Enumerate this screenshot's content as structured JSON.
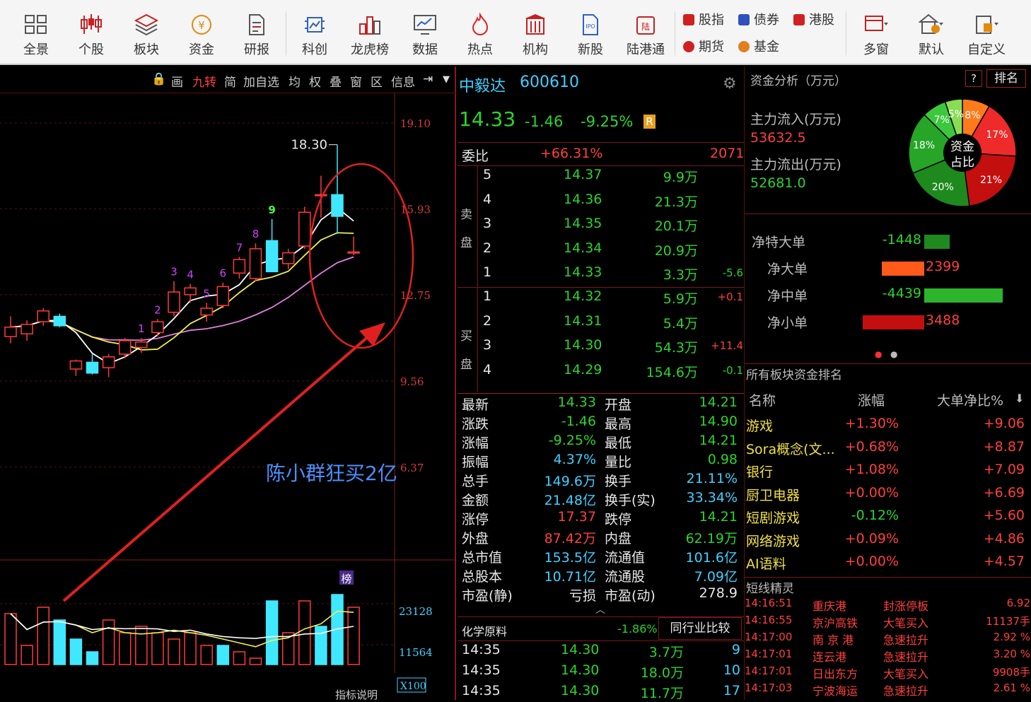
{
  "toolbar": {
    "buttons": [
      {
        "label": "全景",
        "icon": "grid-icon"
      },
      {
        "label": "个股",
        "icon": "candles-icon"
      },
      {
        "label": "板块",
        "icon": "layers-icon"
      },
      {
        "label": "资金",
        "icon": "yen-coin-icon"
      },
      {
        "label": "研报",
        "icon": "document-icon"
      },
      {
        "label": "科创",
        "icon": "chip-icon"
      },
      {
        "label": "龙虎榜",
        "icon": "podium-icon"
      },
      {
        "label": "数据",
        "icon": "monitor-chart-icon"
      },
      {
        "label": "热点",
        "icon": "flame-icon"
      },
      {
        "label": "机构",
        "icon": "building-icon"
      },
      {
        "label": "新股",
        "icon": "ipo-icon"
      },
      {
        "label": "陆港通",
        "icon": "hk-connect-icon"
      }
    ],
    "small": [
      {
        "label": "股指",
        "color": "#d02020"
      },
      {
        "label": "债券",
        "color": "#3050c0"
      },
      {
        "label": "港股",
        "color": "#d02020"
      },
      {
        "label": "期货",
        "color": "#d02020"
      },
      {
        "label": "基金",
        "color": "#e08020"
      }
    ],
    "right": [
      {
        "label": "多窗",
        "icon": "multi-window-icon"
      },
      {
        "label": "默认",
        "icon": "home-clock-icon"
      },
      {
        "label": "自定义",
        "icon": "custom-layout-icon"
      }
    ]
  },
  "chart_toolbar": [
    "画",
    "九转",
    "简",
    "加自选",
    "均",
    "权",
    "叠",
    "窗",
    "区",
    "信息"
  ],
  "chart_data": {
    "type": "candlestick",
    "candles": [
      {
        "o": 11.2,
        "h": 11.95,
        "l": 10.95,
        "c": 11.55
      },
      {
        "o": 11.3,
        "h": 11.8,
        "l": 11.05,
        "c": 11.65
      },
      {
        "o": 11.75,
        "h": 12.25,
        "l": 11.6,
        "c": 12.15
      },
      {
        "o": 11.95,
        "h": 12.05,
        "l": 11.55,
        "c": 11.6
      },
      {
        "o": 10.0,
        "h": 10.35,
        "l": 9.75,
        "c": 10.3
      },
      {
        "o": 10.25,
        "h": 10.55,
        "l": 9.8,
        "c": 9.85
      },
      {
        "o": 10.05,
        "h": 10.55,
        "l": 9.7,
        "c": 10.45
      },
      {
        "o": 10.55,
        "h": 11.15,
        "l": 10.4,
        "c": 11.05
      },
      {
        "o": 10.8,
        "h": 11.15,
        "l": 10.6,
        "c": 11.0
      },
      {
        "o": 11.35,
        "h": 11.85,
        "l": 11.2,
        "c": 11.75
      },
      {
        "o": 12.1,
        "h": 13.25,
        "l": 11.95,
        "c": 12.85
      },
      {
        "o": 12.75,
        "h": 13.15,
        "l": 12.45,
        "c": 13.0
      },
      {
        "o": 12.0,
        "h": 12.45,
        "l": 11.75,
        "c": 12.25
      },
      {
        "o": 12.35,
        "h": 13.2,
        "l": 12.25,
        "c": 13.05
      },
      {
        "o": 13.55,
        "h": 14.15,
        "l": 13.35,
        "c": 14.05
      },
      {
        "o": 13.35,
        "h": 14.65,
        "l": 13.25,
        "c": 14.45
      },
      {
        "o": 14.75,
        "h": 15.55,
        "l": 14.6,
        "c": 13.6
      },
      {
        "o": 13.9,
        "h": 14.45,
        "l": 13.7,
        "c": 14.3
      },
      {
        "o": 14.55,
        "h": 16.0,
        "l": 14.45,
        "c": 15.8
      },
      {
        "o": 16.45,
        "h": 17.15,
        "l": 15.6,
        "c": 16.45
      },
      {
        "o": 16.45,
        "h": 18.3,
        "l": 15.0,
        "c": 15.65
      },
      {
        "o": 14.3,
        "h": 14.9,
        "l": 14.21,
        "c": 14.33
      }
    ],
    "td_labels": [
      "1",
      "2",
      "3",
      "4",
      "5",
      "6",
      "7",
      "8",
      "9"
    ],
    "y_ticks": [
      "19.10",
      "15.93",
      "12.75",
      "9.56",
      "6.37"
    ],
    "high_label": "18.30",
    "annotation": "陈小群狂买2亿",
    "volume_ticks": [
      "23128",
      "11564",
      "X100"
    ],
    "volume": [
      16,
      6,
      18,
      14,
      8,
      4,
      14,
      10,
      12,
      10,
      8,
      10,
      6,
      6,
      4,
      2,
      20,
      10,
      20,
      12,
      22,
      18
    ],
    "volume_up": [
      true,
      true,
      true,
      false,
      false,
      false,
      true,
      true,
      true,
      true,
      true,
      true,
      true,
      false,
      true,
      true,
      false,
      true,
      true,
      false,
      false,
      true
    ],
    "badge": "榜",
    "footer_label": "指标说明"
  },
  "quote": {
    "name": "中毅达",
    "code": "600610",
    "price": "14.33",
    "change": "-1.46",
    "change_pct": "-9.25%",
    "r_badge": "R",
    "weibi_label": "委比",
    "weibi_value": "+66.31%",
    "weibi_num": "2071",
    "sell_label": "卖盘",
    "buy_label": "买盘",
    "sell": [
      {
        "lvl": "5",
        "price": "14.37",
        "vol": "9.9万",
        "chg": ""
      },
      {
        "lvl": "4",
        "price": "14.36",
        "vol": "21.3万",
        "chg": ""
      },
      {
        "lvl": "3",
        "price": "14.35",
        "vol": "20.1万",
        "chg": ""
      },
      {
        "lvl": "2",
        "price": "14.34",
        "vol": "20.9万",
        "chg": ""
      },
      {
        "lvl": "1",
        "price": "14.33",
        "vol": "3.3万",
        "chg": "-5.6"
      }
    ],
    "buy": [
      {
        "lvl": "1",
        "price": "14.32",
        "vol": "5.9万",
        "chg": "+0.1"
      },
      {
        "lvl": "2",
        "price": "14.31",
        "vol": "5.4万",
        "chg": ""
      },
      {
        "lvl": "3",
        "price": "14.30",
        "vol": "54.3万",
        "chg": "+11.4"
      },
      {
        "lvl": "4",
        "price": "14.29",
        "vol": "154.6万",
        "chg": "-0.1"
      }
    ],
    "stats": [
      {
        "k1": "最新",
        "v1": "14.33",
        "c1": "green",
        "k2": "开盘",
        "v2": "14.21",
        "c2": "green"
      },
      {
        "k1": "涨跌",
        "v1": "-1.46",
        "c1": "green",
        "k2": "最高",
        "v2": "14.90",
        "c2": "green"
      },
      {
        "k1": "涨幅",
        "v1": "-9.25%",
        "c1": "green",
        "k2": "最低",
        "v2": "14.21",
        "c2": "green"
      },
      {
        "k1": "振幅",
        "v1": "4.37%",
        "c1": "cyan",
        "k2": "量比",
        "v2": "0.98",
        "c2": "green"
      },
      {
        "k1": "总手",
        "v1": "149.6万",
        "c1": "cyan",
        "k2": "换手",
        "v2": "21.11%",
        "c2": "cyan"
      },
      {
        "k1": "金额",
        "v1": "21.48亿",
        "c1": "cyan",
        "k2": "换手(实)",
        "v2": "33.34%",
        "c2": "cyan"
      },
      {
        "k1": "涨停",
        "v1": "17.37",
        "c1": "red",
        "k2": "跌停",
        "v2": "14.21",
        "c2": "green"
      },
      {
        "k1": "外盘",
        "v1": "87.42万",
        "c1": "red",
        "k2": "内盘",
        "v2": "62.19万",
        "c2": "green"
      },
      {
        "k1": "总市值",
        "v1": "153.5亿",
        "c1": "cyan",
        "k2": "流通值",
        "v2": "101.6亿",
        "c2": "cyan"
      },
      {
        "k1": "总股本",
        "v1": "10.71亿",
        "c1": "cyan",
        "k2": "流通股",
        "v2": "7.09亿",
        "c2": "cyan"
      },
      {
        "k1": "市盈(静)",
        "v1": "亏损",
        "c1": "white",
        "k2": "市盈(动)",
        "v2": "278.9",
        "c2": "white"
      }
    ],
    "industry": "化学原料",
    "industry_pct": "-1.86%",
    "compare_btn": "同行业比较",
    "ticks": [
      {
        "t": "14:35",
        "p": "14.30",
        "v": "3.7万",
        "n": "9"
      },
      {
        "t": "14:35",
        "p": "14.30",
        "v": "18.0万",
        "n": "10"
      },
      {
        "t": "14:35",
        "p": "14.30",
        "v": "11.7万",
        "n": "17"
      }
    ]
  },
  "fund": {
    "title": "资金分析（万元）",
    "help": "?",
    "rank_btn": "排名",
    "inflow_label": "主力流入(万元)",
    "inflow": "53632.5",
    "outflow_label": "主力流出(万元)",
    "outflow": "52681.0",
    "pie_center": [
      "资金",
      "占比"
    ],
    "pie": [
      {
        "label": "8%",
        "value": 8,
        "color": "#ff7a1a"
      },
      {
        "label": "17%",
        "value": 17,
        "color": "#ee2a2a"
      },
      {
        "label": "21%",
        "value": 21,
        "color": "#c40f0f"
      },
      {
        "label": "20%",
        "value": 20,
        "color": "#1e8a1e"
      },
      {
        "label": "18%",
        "value": 18,
        "color": "#27a527"
      },
      {
        "label": "7%",
        "value": 7,
        "color": "#3cc83c"
      },
      {
        "label": "5%",
        "value": 5,
        "color": "#88dd55"
      }
    ],
    "net": [
      {
        "label": "净特大单",
        "value": "-1448",
        "amount": -1448,
        "color": "#1e8a1e"
      },
      {
        "label": "净大单",
        "value": "2399",
        "amount": 2399,
        "color": "#ff5a1a"
      },
      {
        "label": "净中单",
        "value": "-4439",
        "amount": -4439,
        "color": "#2cb52c"
      },
      {
        "label": "净小单",
        "value": "3488",
        "amount": 3488,
        "color": "#c40f0f"
      }
    ],
    "sector_title": "所有板块资金排名",
    "sector_headers": [
      "名称",
      "涨幅",
      "大单净比%"
    ],
    "sectors": [
      {
        "name": "游戏",
        "pct": "+1.30%",
        "ratio": "+9.06"
      },
      {
        "name": "Sora概念(文...",
        "pct": "+0.68%",
        "ratio": "+8.87"
      },
      {
        "name": "银行",
        "pct": "+1.08%",
        "ratio": "+7.09"
      },
      {
        "name": "厨卫电器",
        "pct": "+0.00%",
        "ratio": "+6.69"
      },
      {
        "name": "短剧游戏",
        "pct": "-0.12%",
        "ratio": "+5.60"
      },
      {
        "name": "网络游戏",
        "pct": "+0.09%",
        "ratio": "+4.86"
      },
      {
        "name": "AI语料",
        "pct": "+0.00%",
        "ratio": "+4.57"
      }
    ],
    "sprite_title": "短线精灵",
    "sprites": [
      {
        "t": "14:16:51",
        "name": "重庆港",
        "ev": "封涨停板",
        "val": "6.92"
      },
      {
        "t": "14:16:55",
        "name": "京沪高铁",
        "ev": "大笔买入",
        "val": "11137手"
      },
      {
        "t": "14:17:00",
        "name": "南 京 港",
        "ev": "急速拉升",
        "val": "2.92 %"
      },
      {
        "t": "14:17:01",
        "name": "连云港",
        "ev": "急速拉升",
        "val": "3.20 %"
      },
      {
        "t": "14:17:01",
        "name": "日出东方",
        "ev": "大笔买入",
        "val": "9908手"
      },
      {
        "t": "14:17:03",
        "name": "宁波海运",
        "ev": "急速拉升",
        "val": "2.61 %"
      }
    ]
  }
}
